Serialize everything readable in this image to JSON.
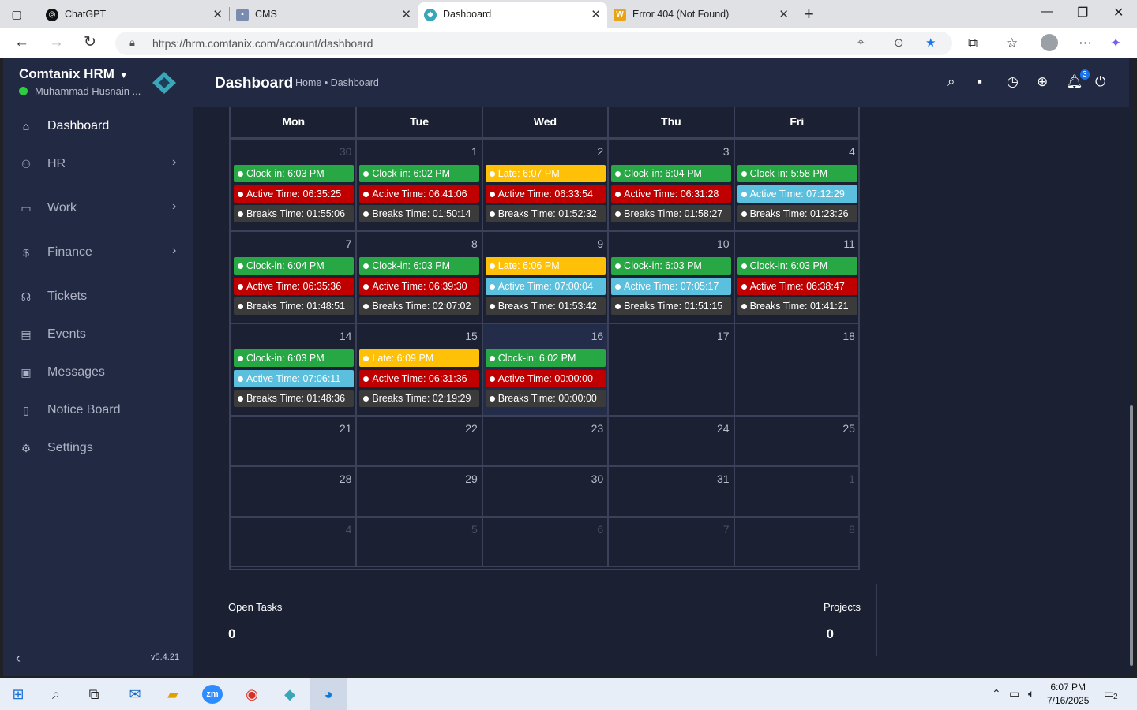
{
  "browser": {
    "tabs": [
      {
        "label": "ChatGPT",
        "icon": "chatgpt-icon"
      },
      {
        "label": "CMS",
        "icon": "cms-icon"
      },
      {
        "label": "Dashboard",
        "icon": "comtanix-icon"
      },
      {
        "label": "Error 404 (Not Found)",
        "icon": "w-icon"
      }
    ],
    "url": "https://hrm.comtanix.com/account/dashboard"
  },
  "sidebar": {
    "brand": "Comtanix HRM",
    "user": "Muhammad Husnain ...",
    "items": [
      {
        "label": "Dashboard",
        "icon": "home-icon"
      },
      {
        "label": "HR",
        "icon": "users-icon"
      },
      {
        "label": "Work",
        "icon": "briefcase-icon"
      },
      {
        "label": "Finance",
        "icon": "dollar-icon"
      },
      {
        "label": "Tickets",
        "icon": "headset-icon"
      },
      {
        "label": "Events",
        "icon": "calendar-icon"
      },
      {
        "label": "Messages",
        "icon": "message-icon"
      },
      {
        "label": "Notice Board",
        "icon": "clipboard-icon"
      },
      {
        "label": "Settings",
        "icon": "gear-icon"
      }
    ],
    "version": "v5.4.21"
  },
  "header": {
    "title": "Dashboard",
    "breadcrumb": "Home • Dashboard",
    "notif_count": "3"
  },
  "calendar": {
    "days": [
      "Mon",
      "Tue",
      "Wed",
      "Thu",
      "Fri"
    ],
    "weeks": [
      [
        {
          "n": "30",
          "other": true,
          "ev": [
            [
              "green",
              "Clock-in: 6:03 PM"
            ],
            [
              "red",
              "Active Time: 06:35:25"
            ],
            [
              "gray",
              "Breaks Time: 01:55:06"
            ]
          ]
        },
        {
          "n": "1",
          "ev": [
            [
              "green",
              "Clock-in: 6:02 PM"
            ],
            [
              "red",
              "Active Time: 06:41:06"
            ],
            [
              "gray",
              "Breaks Time: 01:50:14"
            ]
          ]
        },
        {
          "n": "2",
          "ev": [
            [
              "yellow",
              "Late: 6:07 PM"
            ],
            [
              "red",
              "Active Time: 06:33:54"
            ],
            [
              "gray",
              "Breaks Time: 01:52:32"
            ]
          ]
        },
        {
          "n": "3",
          "ev": [
            [
              "green",
              "Clock-in: 6:04 PM"
            ],
            [
              "red",
              "Active Time: 06:31:28"
            ],
            [
              "gray",
              "Breaks Time: 01:58:27"
            ]
          ]
        },
        {
          "n": "4",
          "ev": [
            [
              "green",
              "Clock-in: 5:58 PM"
            ],
            [
              "teal",
              "Active Time: 07:12:29"
            ],
            [
              "gray",
              "Breaks Time: 01:23:26"
            ]
          ]
        }
      ],
      [
        {
          "n": "7",
          "ev": [
            [
              "green",
              "Clock-in: 6:04 PM"
            ],
            [
              "red",
              "Active Time: 06:35:36"
            ],
            [
              "gray",
              "Breaks Time: 01:48:51"
            ]
          ]
        },
        {
          "n": "8",
          "ev": [
            [
              "green",
              "Clock-in: 6:03 PM"
            ],
            [
              "red",
              "Active Time: 06:39:30"
            ],
            [
              "gray",
              "Breaks Time: 02:07:02"
            ]
          ]
        },
        {
          "n": "9",
          "ev": [
            [
              "yellow",
              "Late: 6:06 PM"
            ],
            [
              "teal",
              "Active Time: 07:00:04"
            ],
            [
              "gray",
              "Breaks Time: 01:53:42"
            ]
          ]
        },
        {
          "n": "10",
          "ev": [
            [
              "green",
              "Clock-in: 6:03 PM"
            ],
            [
              "teal",
              "Active Time: 07:05:17"
            ],
            [
              "gray",
              "Breaks Time: 01:51:15"
            ]
          ]
        },
        {
          "n": "11",
          "ev": [
            [
              "green",
              "Clock-in: 6:03 PM"
            ],
            [
              "red",
              "Active Time: 06:38:47"
            ],
            [
              "gray",
              "Breaks Time: 01:41:21"
            ]
          ]
        }
      ],
      [
        {
          "n": "14",
          "ev": [
            [
              "green",
              "Clock-in: 6:03 PM"
            ],
            [
              "teal",
              "Active Time: 07:06:11"
            ],
            [
              "gray",
              "Breaks Time: 01:48:36"
            ]
          ]
        },
        {
          "n": "15",
          "ev": [
            [
              "yellow",
              "Late: 6:09 PM"
            ],
            [
              "red",
              "Active Time: 06:31:36"
            ],
            [
              "gray",
              "Breaks Time: 02:19:29"
            ]
          ]
        },
        {
          "n": "16",
          "today": true,
          "ev": [
            [
              "green",
              "Clock-in: 6:02 PM"
            ],
            [
              "red",
              "Active Time: 00:00:00"
            ],
            [
              "gray",
              "Breaks Time: 00:00:00"
            ]
          ]
        },
        {
          "n": "17",
          "ev": []
        },
        {
          "n": "18",
          "ev": []
        }
      ],
      [
        {
          "n": "21",
          "ev": []
        },
        {
          "n": "22",
          "ev": []
        },
        {
          "n": "23",
          "ev": []
        },
        {
          "n": "24",
          "ev": []
        },
        {
          "n": "25",
          "ev": []
        }
      ],
      [
        {
          "n": "28",
          "ev": []
        },
        {
          "n": "29",
          "ev": []
        },
        {
          "n": "30",
          "ev": []
        },
        {
          "n": "31",
          "ev": []
        },
        {
          "n": "1",
          "other": true,
          "ev": []
        }
      ],
      [
        {
          "n": "4",
          "other": true,
          "ev": []
        },
        {
          "n": "5",
          "other": true,
          "ev": []
        },
        {
          "n": "6",
          "other": true,
          "ev": []
        },
        {
          "n": "7",
          "other": true,
          "ev": []
        },
        {
          "n": "8",
          "other": true,
          "ev": []
        }
      ]
    ]
  },
  "stats": {
    "open_tasks_label": "Open Tasks",
    "open_tasks_value": "0",
    "projects_label": "Projects",
    "projects_value": "0"
  },
  "taskbar": {
    "time": "6:07 PM",
    "date": "7/16/2025",
    "notif_count": "2"
  }
}
